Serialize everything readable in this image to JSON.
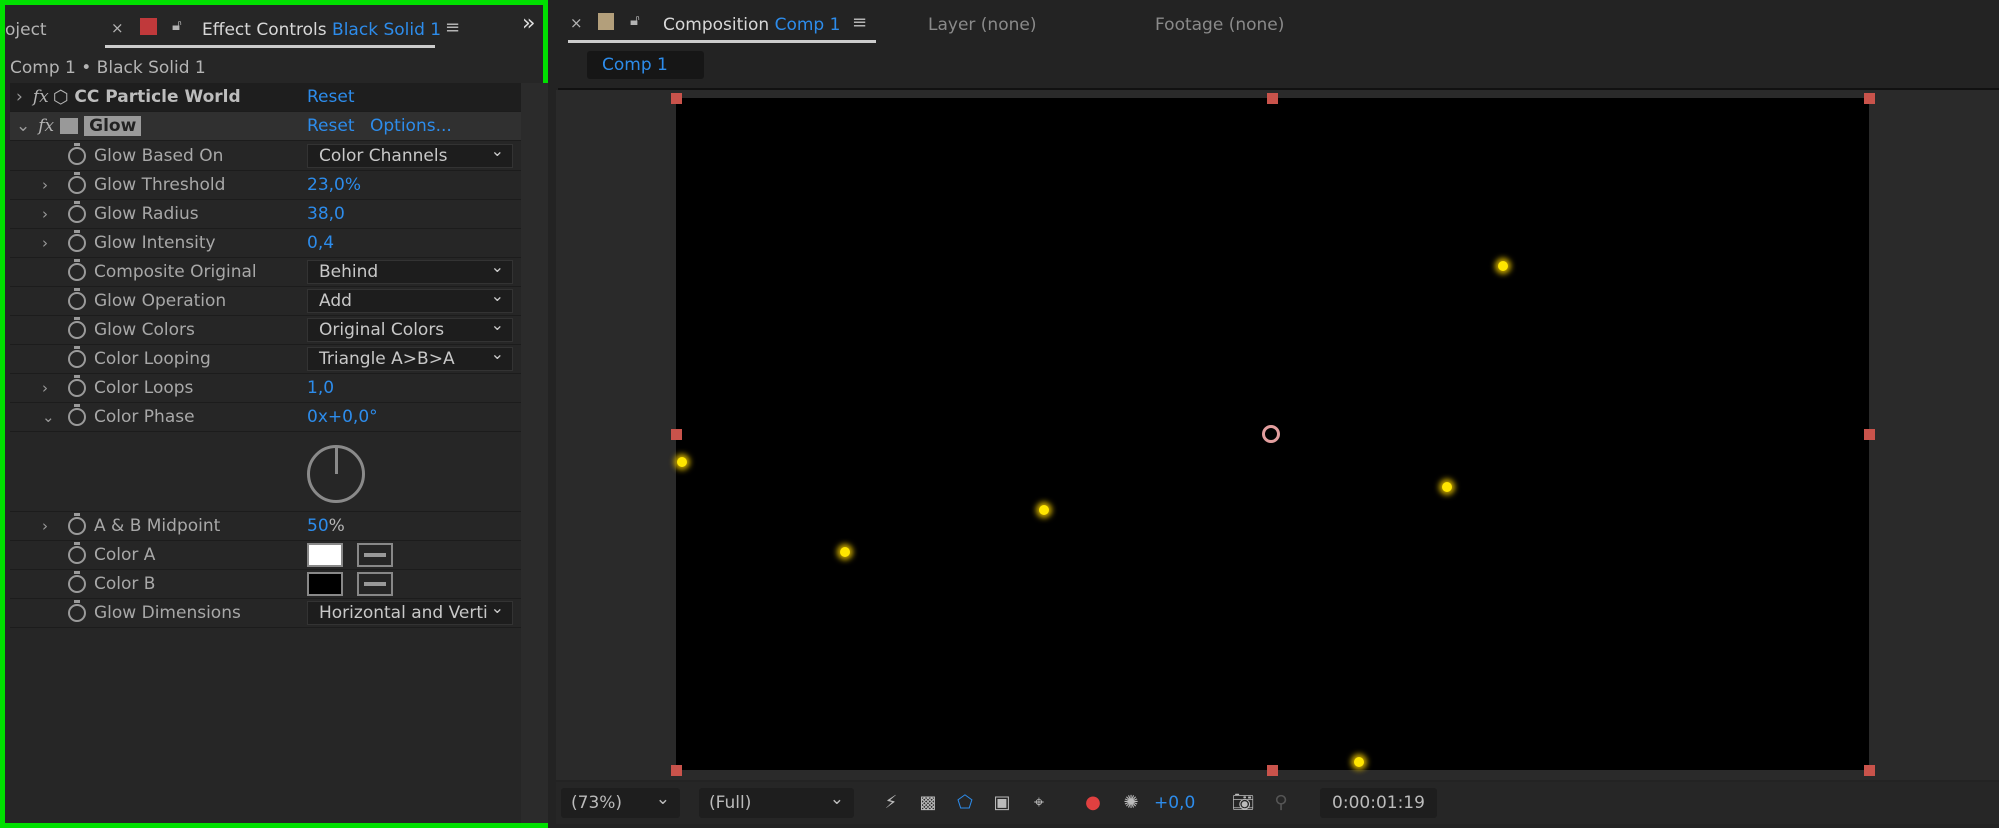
{
  "left_panel": {
    "tabs": {
      "project": "oject",
      "effect_controls": "Effect Controls",
      "effect_target": "Black Solid 1",
      "overflow": "»"
    },
    "breadcrumb": "Comp 1 • Black Solid 1",
    "effects": [
      {
        "name": "CC Particle World",
        "reset": "Reset"
      },
      {
        "name": "Glow",
        "reset": "Reset",
        "options": "Options..."
      }
    ],
    "properties": [
      {
        "label": "Glow Based On",
        "type": "dropdown",
        "value": "Color Channels"
      },
      {
        "label": "Glow Threshold",
        "type": "value",
        "value": "23,0%"
      },
      {
        "label": "Glow Radius",
        "type": "value",
        "value": "38,0"
      },
      {
        "label": "Glow Intensity",
        "type": "value",
        "value": "0,4"
      },
      {
        "label": "Composite Original",
        "type": "dropdown",
        "value": "Behind"
      },
      {
        "label": "Glow Operation",
        "type": "dropdown",
        "value": "Add"
      },
      {
        "label": "Glow Colors",
        "type": "dropdown",
        "value": "Original Colors"
      },
      {
        "label": "Color Looping",
        "type": "dropdown",
        "value": "Triangle A>B>A"
      },
      {
        "label": "Color Loops",
        "type": "value",
        "value": "1,0"
      },
      {
        "label": "Color Phase",
        "type": "value",
        "value": "0x+0,0°"
      },
      {
        "label": "A & B Midpoint",
        "type": "value",
        "value": "50",
        "unit": "%"
      },
      {
        "label": "Color A",
        "type": "color",
        "value": "#ffffff"
      },
      {
        "label": "Color B",
        "type": "color",
        "value": "#000000"
      },
      {
        "label": "Glow Dimensions",
        "type": "dropdown",
        "value": "Horizontal and Verti"
      }
    ]
  },
  "right_panel": {
    "tabs": {
      "composition": "Composition",
      "comp_name": "Comp 1",
      "layer": "Layer (none)",
      "footage": "Footage (none)"
    },
    "comp_button": "Comp 1",
    "toolbar": {
      "zoom": "(73%)",
      "resolution": "(Full)",
      "exposure": "+0,0",
      "timecode": "0:00:01:19"
    }
  },
  "colors": {
    "accent": "#2d8ceb",
    "highlight": "#00e000",
    "handle": "#c9534b",
    "particle": "#ffe600"
  }
}
